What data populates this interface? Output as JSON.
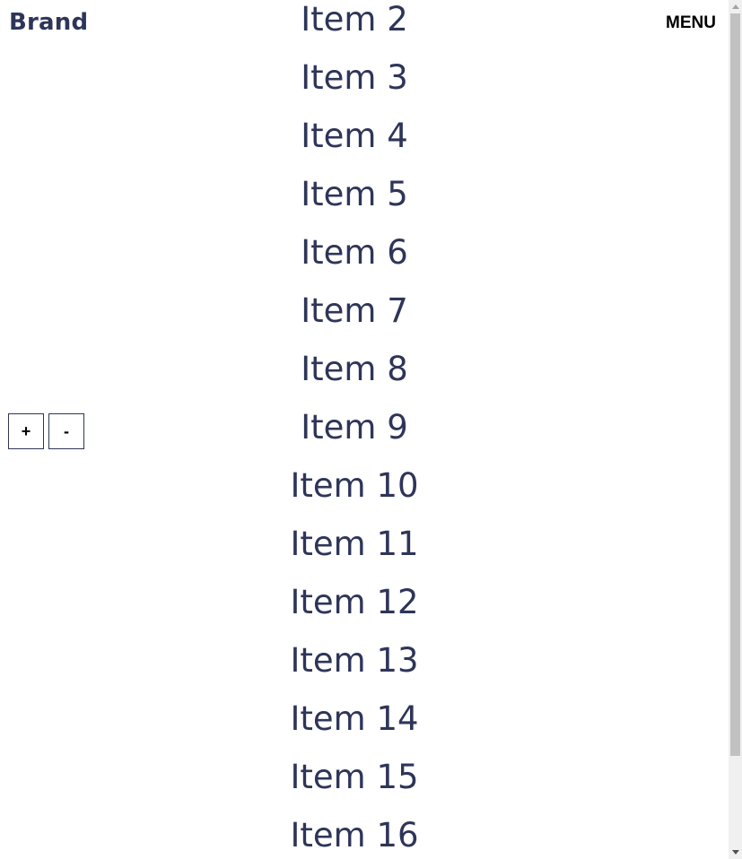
{
  "header": {
    "brand": "Brand",
    "menu_label": "MENU"
  },
  "zoom_controls": {
    "zoom_in_label": "+",
    "zoom_out_label": "-"
  },
  "list": {
    "items": [
      "Item 2",
      "Item 3",
      "Item 4",
      "Item 5",
      "Item 6",
      "Item 7",
      "Item 8",
      "Item 9",
      "Item 10",
      "Item 11",
      "Item 12",
      "Item 13",
      "Item 14",
      "Item 15",
      "Item 16"
    ]
  },
  "scrollbar": {
    "visible_fraction": 0.88,
    "scroll_position": 0.0
  },
  "colors": {
    "text": "#2e3559",
    "scroll_track": "#f0f0f0",
    "scroll_thumb": "#c1c1c1"
  }
}
